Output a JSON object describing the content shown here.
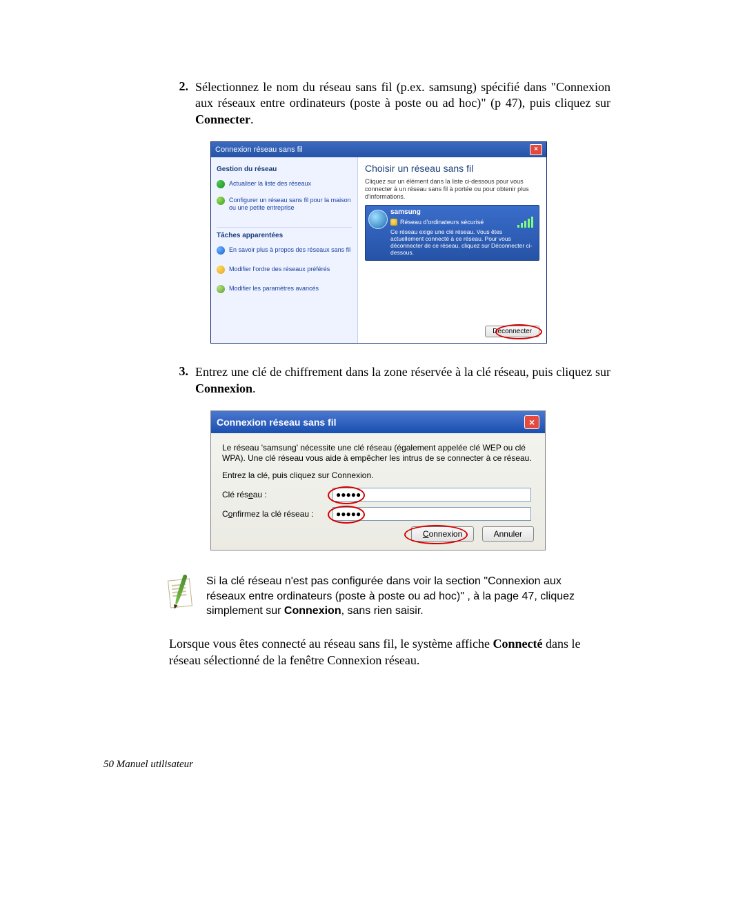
{
  "step2": {
    "num": "2.",
    "text_a": "Sélectionnez le nom du réseau sans fil (p.ex. samsung) spécifié dans  \"Connexion aux réseaux entre ordinateurs (poste à poste ou ad hoc)\" (p 47), puis cliquez sur ",
    "bold": "Connecter",
    "text_b": "."
  },
  "dlg1": {
    "title": "Connexion réseau sans fil",
    "left": {
      "h1": "Gestion du réseau",
      "l1": "Actualiser la liste des réseaux",
      "l2": "Configurer un réseau sans fil pour la maison ou une petite entreprise",
      "h2": "Tâches apparentées",
      "l3": "En savoir plus à propos des réseaux sans fil",
      "l4": "Modifier l'ordre des réseaux préférés",
      "l5": "Modifier les paramètres avancés"
    },
    "right": {
      "heading": "Choisir un réseau sans fil",
      "instr": "Cliquez sur un élément dans la liste ci-dessous pour vous connecter à un réseau sans fil à portée ou pour obtenir plus d'informations.",
      "net_name": "samsung",
      "net_type": "Réseau d'ordinateurs sécurisé",
      "net_detail": "Ce réseau exige une clé réseau. Vous êtes actuellement connecté à ce réseau. Pour vous déconnecter de ce réseau, cliquez sur Déconnecter ci-dessous.",
      "button": "Déconnecter"
    }
  },
  "step3": {
    "num": "3.",
    "text_a": "Entrez une clé de chiffrement dans la zone réservée à la clé réseau, puis cliquez sur ",
    "bold": "Connexion",
    "text_b": "."
  },
  "dlg2": {
    "title": "Connexion réseau sans fil",
    "para1": "Le réseau 'samsung' nécessite une clé réseau (également appelée clé WEP ou clé WPA). Une clé réseau vous aide à empêcher les intrus de se connecter à ce réseau.",
    "para2": "Entrez la clé, puis cliquez sur Connexion.",
    "label1_pre": "Clé rés",
    "label1_u": "e",
    "label1_post": "au :",
    "label2_pre": "C",
    "label2_u": "o",
    "label2_post": "nfirmez la clé réseau :",
    "masked": "●●●●●",
    "btn_connect_pre": "",
    "btn_connect_u": "C",
    "btn_connect_post": "onnexion",
    "btn_cancel": "Annuler"
  },
  "note": {
    "t1": "Si la clé réseau n'est pas configurée dans voir la section \"Connexion aux réseaux entre ordinateurs (poste à poste ou ad hoc)\" , à la page 47, cliquez simplement sur ",
    "bold": "Connexion",
    "t2": ", sans rien saisir."
  },
  "para_final": {
    "t1": "Lorsque vous êtes connecté au réseau sans fil, le système affiche ",
    "bold": "Connecté",
    "t2": " dans le réseau sélectionné de la fenêtre Connexion réseau."
  },
  "footer": "50  Manuel utilisateur"
}
